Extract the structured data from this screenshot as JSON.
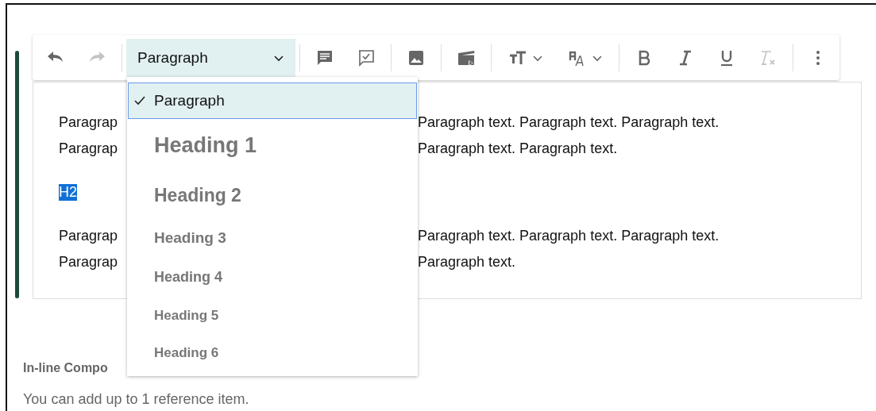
{
  "toolbar": {
    "groups": [
      {
        "items": [
          {
            "kind": "undo",
            "disabled": false
          },
          {
            "kind": "redo",
            "disabled": true
          }
        ]
      },
      {
        "items": [
          {
            "kind": "select",
            "value": "Paragraph"
          }
        ]
      },
      {
        "items": [
          {
            "kind": "comment",
            "disabled": false
          },
          {
            "kind": "comment-check",
            "disabled": false
          }
        ]
      },
      {
        "items": [
          {
            "kind": "image",
            "disabled": false
          }
        ]
      },
      {
        "items": [
          {
            "kind": "video",
            "disabled": false
          }
        ]
      },
      {
        "items": [
          {
            "kind": "text-size",
            "disabled": false
          },
          {
            "kind": "font",
            "disabled": false
          }
        ]
      },
      {
        "items": [
          {
            "kind": "bold",
            "disabled": false
          },
          {
            "kind": "italic",
            "disabled": false
          },
          {
            "kind": "underline",
            "disabled": false
          },
          {
            "kind": "clear-format",
            "disabled": true
          }
        ]
      },
      {
        "items": [
          {
            "kind": "more",
            "disabled": false
          }
        ]
      }
    ]
  },
  "format_menu": {
    "options": [
      {
        "label": "Paragraph",
        "kind": "p",
        "selected": true
      },
      {
        "label": "Heading 1",
        "kind": "h1",
        "selected": false
      },
      {
        "label": "Heading 2",
        "kind": "h2",
        "selected": false
      },
      {
        "label": "Heading 3",
        "kind": "h3",
        "selected": false
      },
      {
        "label": "Heading 4",
        "kind": "h4",
        "selected": false
      },
      {
        "label": "Heading 5",
        "kind": "h5",
        "selected": false
      },
      {
        "label": "Heading 6",
        "kind": "h6",
        "selected": false
      }
    ]
  },
  "editor": {
    "blocks": [
      {
        "kind": "paragraph",
        "lines": [
          {
            "left": "Paragrap",
            "right": "Paragraph text. Paragraph text. Paragraph text."
          },
          {
            "left": "Paragrap",
            "right": "Paragraph text. Paragraph text."
          }
        ]
      },
      {
        "kind": "heading",
        "text": "H2",
        "highlighted": true
      },
      {
        "kind": "paragraph",
        "lines": [
          {
            "left": "Paragrap",
            "right": "Paragraph text. Paragraph text. Paragraph text."
          },
          {
            "left": "Paragrap",
            "right": "Paragraph text."
          }
        ]
      }
    ]
  },
  "footer": {
    "label": "In-line Compo",
    "hint": "You can add up to 1 reference item."
  }
}
